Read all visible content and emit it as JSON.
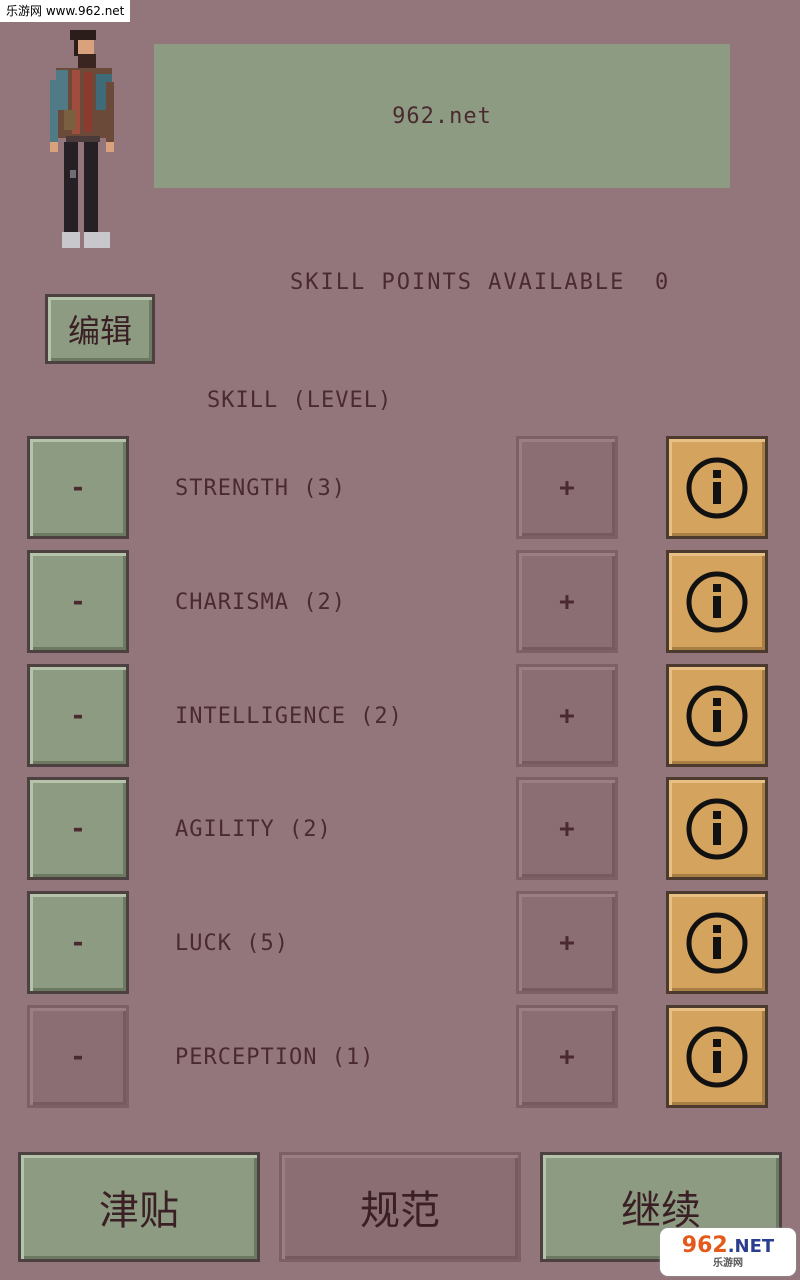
{
  "watermark": "乐游网 www.962.net",
  "name_box": "962.net",
  "skill_points": {
    "label": "SKILL POINTS AVAILABLE",
    "value": "0"
  },
  "edit_label": "编辑",
  "skill_header": "SKILL (LEVEL)",
  "minus_label": "-",
  "plus_label": "+",
  "skills": [
    {
      "label": "STRENGTH (3)",
      "minus_enabled": true
    },
    {
      "label": "CHARISMA (2)",
      "minus_enabled": true
    },
    {
      "label": "INTELLIGENCE (2)",
      "minus_enabled": true
    },
    {
      "label": "AGILITY (2)",
      "minus_enabled": true
    },
    {
      "label": "LUCK (5)",
      "minus_enabled": true
    },
    {
      "label": "PERCEPTION (1)",
      "minus_enabled": false
    }
  ],
  "bottom": {
    "left_label": "津贴",
    "middle_label": "规范",
    "right_label": "继续"
  },
  "logo": {
    "main": "962",
    "suffix": ".NET",
    "sub": "乐游网"
  },
  "colors": {
    "background": "#93767c",
    "button_green": "#8d9b82",
    "info_gold": "#d4a35e",
    "text": "#4a2a30"
  },
  "icons": [
    "info-icon",
    "character-avatar"
  ]
}
